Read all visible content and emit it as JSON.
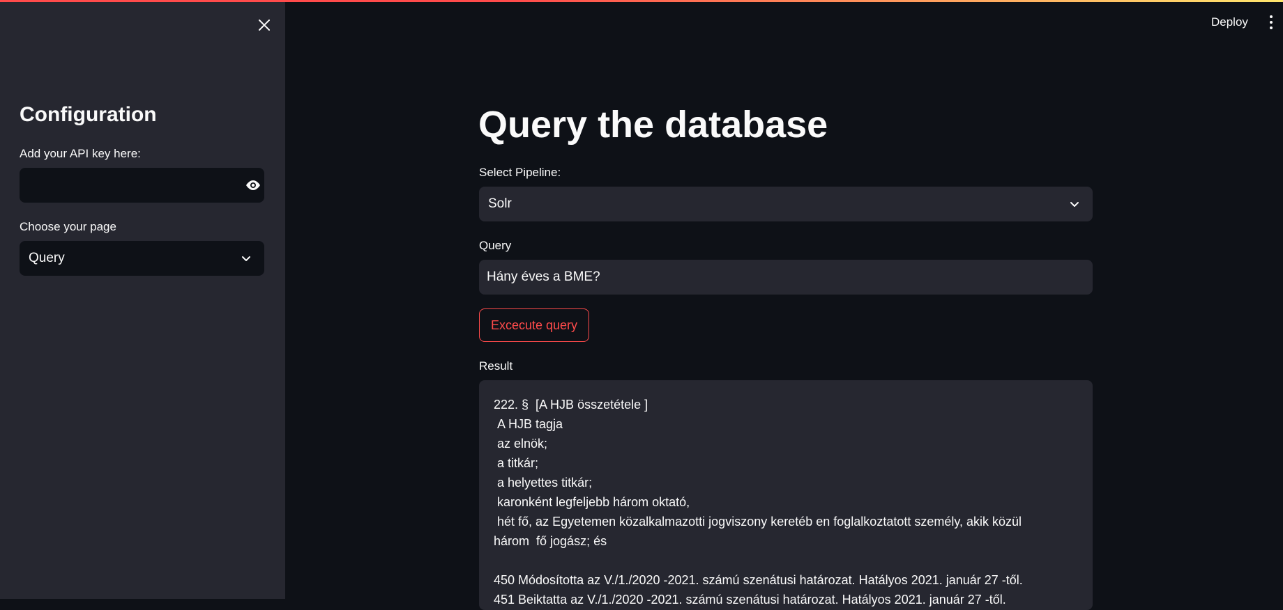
{
  "colors": {
    "background": "#0e1117",
    "sidebar": "#262730",
    "accent": "#ff4b4b",
    "text": "#fafafa"
  },
  "header": {
    "deploy_label": "Deploy",
    "menu_icon": "kebab-menu-icon"
  },
  "sidebar": {
    "close_icon": "close-icon",
    "title": "Configuration",
    "api_key_label": "Add your API key here:",
    "api_key_value": "",
    "visibility_icon": "eye-icon",
    "page_label": "Choose your page",
    "page_value": "Query"
  },
  "main": {
    "title": "Query the database",
    "pipeline_label": "Select Pipeline:",
    "pipeline_value": "Solr",
    "query_label": "Query",
    "query_value": "Hány éves a BME?",
    "execute_label": "Excecute query",
    "result_label": "Result",
    "result_text": "222. §  [A HJB összetétele ]\n A HJB tagja\n az elnök;\n a titkár;\n a helyettes titkár;\n karonként legfeljebb három oktató,\n hét fő, az Egyetemen közalkalmazotti jogviszony keretéb en foglalkoztatott személy, akik közül\nhárom  fő jogász; és\n\n450 Módosította az V./1./2020 -2021. számú szenátusi határozat. Hatályos 2021. január 27 -től.\n451 Beiktatta az V./1./2020 -2021. számú szenátusi határozat. Hatályos 2021. január 27 -től."
  }
}
